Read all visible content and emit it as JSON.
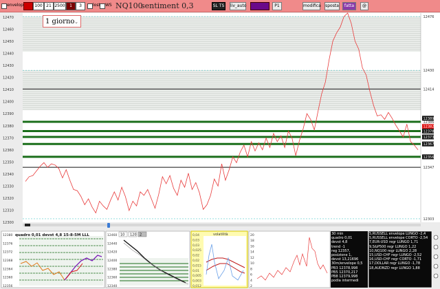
{
  "toolbar": {
    "envelope_label": "envelope",
    "fields": [
      "100",
      "21",
      "2500"
    ],
    "dark_value": "1",
    "field_3": "3",
    "lost_label": "lost",
    "ws_label": "WS",
    "title": "NQ100",
    "sentiment": "sentiment 0,3",
    "sl_ts": "SL TS",
    "liv_auto": "liv_auto",
    "p1": "P1",
    "modifica": "modifica",
    "sposta": "sposta",
    "fatta": "fatta",
    "at": "@"
  },
  "timeframe": "1 giorno",
  "colors": {
    "accent": "#f08a8a",
    "green_line": "#1a6e1a",
    "price_line": "#e83a3a"
  },
  "main_chart": {
    "y_ticks": [
      "12470",
      "12460",
      "12450",
      "12440",
      "12430",
      "12420",
      "12410",
      "12400",
      "12390",
      "12380",
      "12370",
      "12360",
      "12350",
      "12340",
      "12330",
      "12320",
      "12310",
      "12300"
    ],
    "y_range": [
      12300,
      12479
    ],
    "right_labels": [
      {
        "value": 12476,
        "text": "12476",
        "style": "plain"
      },
      {
        "value": 12430,
        "text": "12430",
        "style": "plain"
      },
      {
        "value": 12414,
        "text": "12414",
        "style": "plain"
      },
      {
        "value": 12389,
        "text": "12389",
        "style": "dark"
      },
      {
        "value": 12386,
        "text": "12386",
        "style": "plain"
      },
      {
        "value": 12382,
        "text": "12382",
        "style": "red"
      },
      {
        "value": 12378,
        "text": "12378",
        "style": "dark"
      },
      {
        "value": 12373,
        "text": "12373",
        "style": "dark"
      },
      {
        "value": 12367,
        "text": "12367",
        "style": "dark"
      },
      {
        "value": 12356,
        "text": "12356",
        "style": "dark"
      },
      {
        "value": 12347,
        "text": "12347",
        "style": "plain"
      },
      {
        "value": 12303,
        "text": "12303",
        "style": "plain"
      }
    ],
    "shaded_zones": [
      [
        12446,
        12476
      ],
      [
        12396,
        12430
      ]
    ],
    "green_lines": [
      12386,
      12378,
      12373,
      12367,
      12356
    ],
    "black_lines": [
      12414,
      12347
    ],
    "dashed_lines": [
      12476,
      12430,
      12303
    ],
    "price": [
      12335,
      12339,
      12340,
      12344,
      12348,
      12351,
      12347,
      12350,
      12349,
      12346,
      12338,
      12345,
      12336,
      12328,
      12327,
      12322,
      12315,
      12320,
      12313,
      12308,
      12318,
      12314,
      12311,
      12319,
      12326,
      12319,
      12330,
      12322,
      12310,
      12318,
      12314,
      12326,
      12323,
      12328,
      12320,
      12312,
      12324,
      12339,
      12333,
      12340,
      12329,
      12323,
      12336,
      12330,
      12342,
      12328,
      12334,
      12325,
      12311,
      12315,
      12323,
      12337,
      12331,
      12350,
      12336,
      12345,
      12356,
      12351,
      12360,
      12366,
      12356,
      12369,
      12361,
      12368,
      12362,
      12372,
      12364,
      12376,
      12369,
      12374,
      12364,
      12378,
      12372,
      12357,
      12370,
      12380,
      12393,
      12388,
      12379,
      12395,
      12410,
      12420,
      12439,
      12455,
      12462,
      12467,
      12476,
      12479,
      12470,
      12455,
      12448,
      12432,
      12426,
      12412,
      12400,
      12391,
      12392,
      12388,
      12394,
      12389,
      12383,
      12378,
      12373,
      12384,
      12369,
      12366,
      12362
    ]
  },
  "panels": {
    "p1": {
      "title": "quadro 0,01  devst 4,8  15-8-5M  LLL",
      "ticks": [
        "12380",
        "12376",
        "12372",
        "12368",
        "12364",
        "12360",
        "12356"
      ]
    },
    "p2": {
      "tabs": [
        "10",
        "120",
        "2"
      ],
      "ticks": [
        "12460",
        "12440",
        "12420",
        "12400",
        "12380",
        "12360",
        "12340"
      ]
    },
    "p3": {
      "label": "volatilità",
      "ticks": [
        "0,04",
        "0,03",
        "0,03",
        "0,025",
        "0,02",
        "0,02",
        "0,015",
        "0,01",
        "0,005",
        "0,003",
        "0,012"
      ]
    },
    "p4": {
      "ticks": [
        "20",
        "18",
        "16",
        "14",
        "12",
        "10",
        "8",
        "6",
        "4",
        "2"
      ]
    },
    "p5_lines": [
      "30 min",
      "quadro 0,01",
      "devst 4,8",
      "trend -1",
      "reg 12357,",
      "posizione 1,",
      "devst 13,21696",
      "30m/envelope 0,5",
      "PB3 12378,998",
      "PB5 12370,217",
      "PB8 12379,998",
      "podia intermedi"
    ],
    "p6_lines": [
      "5,RUSSELL envelope LUNGO -2,4",
      "5,RUSSELL envelope CORTO -2,54",
      "7,EUR-USD regr LUNGO 1,71",
      "9,S&P500 regr LUNGO 1,22",
      "10,NQ100 regr LUNGO 2,28",
      "15,USD-CHF regr LUNGO -2,52",
      "16,USD-CHF regr CORTO -1,71",
      "17,DOLLAR regr LUNGO -1,78",
      "18,AUDNZD regr LUNGO 1,88"
    ]
  }
}
